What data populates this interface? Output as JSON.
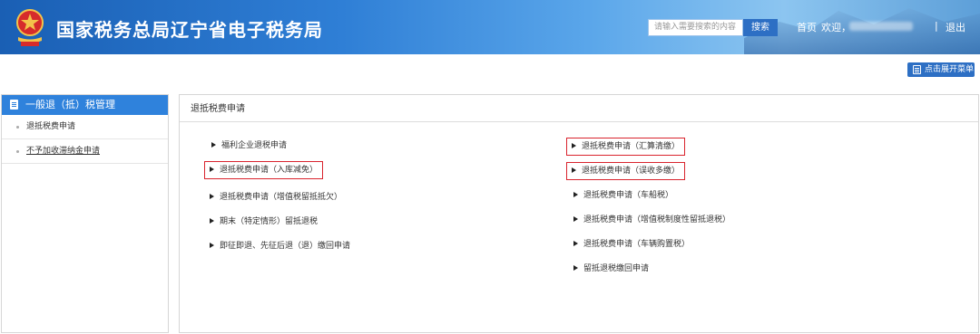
{
  "header": {
    "title": "国家税务总局辽宁省电子税务局",
    "search_placeholder": "请输入需要搜索的内容",
    "search_button": "搜索",
    "nav_home": "首页",
    "nav_welcome": "欢迎，",
    "nav_separator": "|",
    "nav_logout": "退出"
  },
  "toolbar": {
    "expand_menu_label": "点击展开菜单"
  },
  "sidebar": {
    "header": "一般退（抵）税管理",
    "items": [
      {
        "label": "退抵税费申请"
      },
      {
        "label": "不予加收滞纳金申请"
      }
    ]
  },
  "main": {
    "title": "退抵税费申请",
    "left_links": [
      {
        "label": "福利企业退税申请",
        "highlighted": false
      },
      {
        "label": "退抵税费申请（入库减免）",
        "highlighted": true
      },
      {
        "label": "退抵税费申请（增值税留抵抵欠）",
        "highlighted": false
      },
      {
        "label": "期末（特定情形）留抵退税",
        "highlighted": false
      },
      {
        "label": "即征即退、先征后退（退）缴回申请",
        "highlighted": false
      }
    ],
    "right_links": [
      {
        "label": "退抵税费申请（汇算清缴）",
        "highlighted": true
      },
      {
        "label": "退抵税费申请（误收多缴）",
        "highlighted": true
      },
      {
        "label": "退抵税费申请（车船税）",
        "highlighted": false
      },
      {
        "label": "退抵税费申请（增值税制度性留抵退税）",
        "highlighted": false
      },
      {
        "label": "退抵税费申请（车辆购置税）",
        "highlighted": false
      },
      {
        "label": "留抵退税缴回申请",
        "highlighted": false
      }
    ]
  },
  "colors": {
    "header_blue": "#2f7fd6",
    "sidebar_header": "#2f82dc",
    "highlight_border": "#d9232d",
    "button_blue": "#2d6fc4"
  }
}
